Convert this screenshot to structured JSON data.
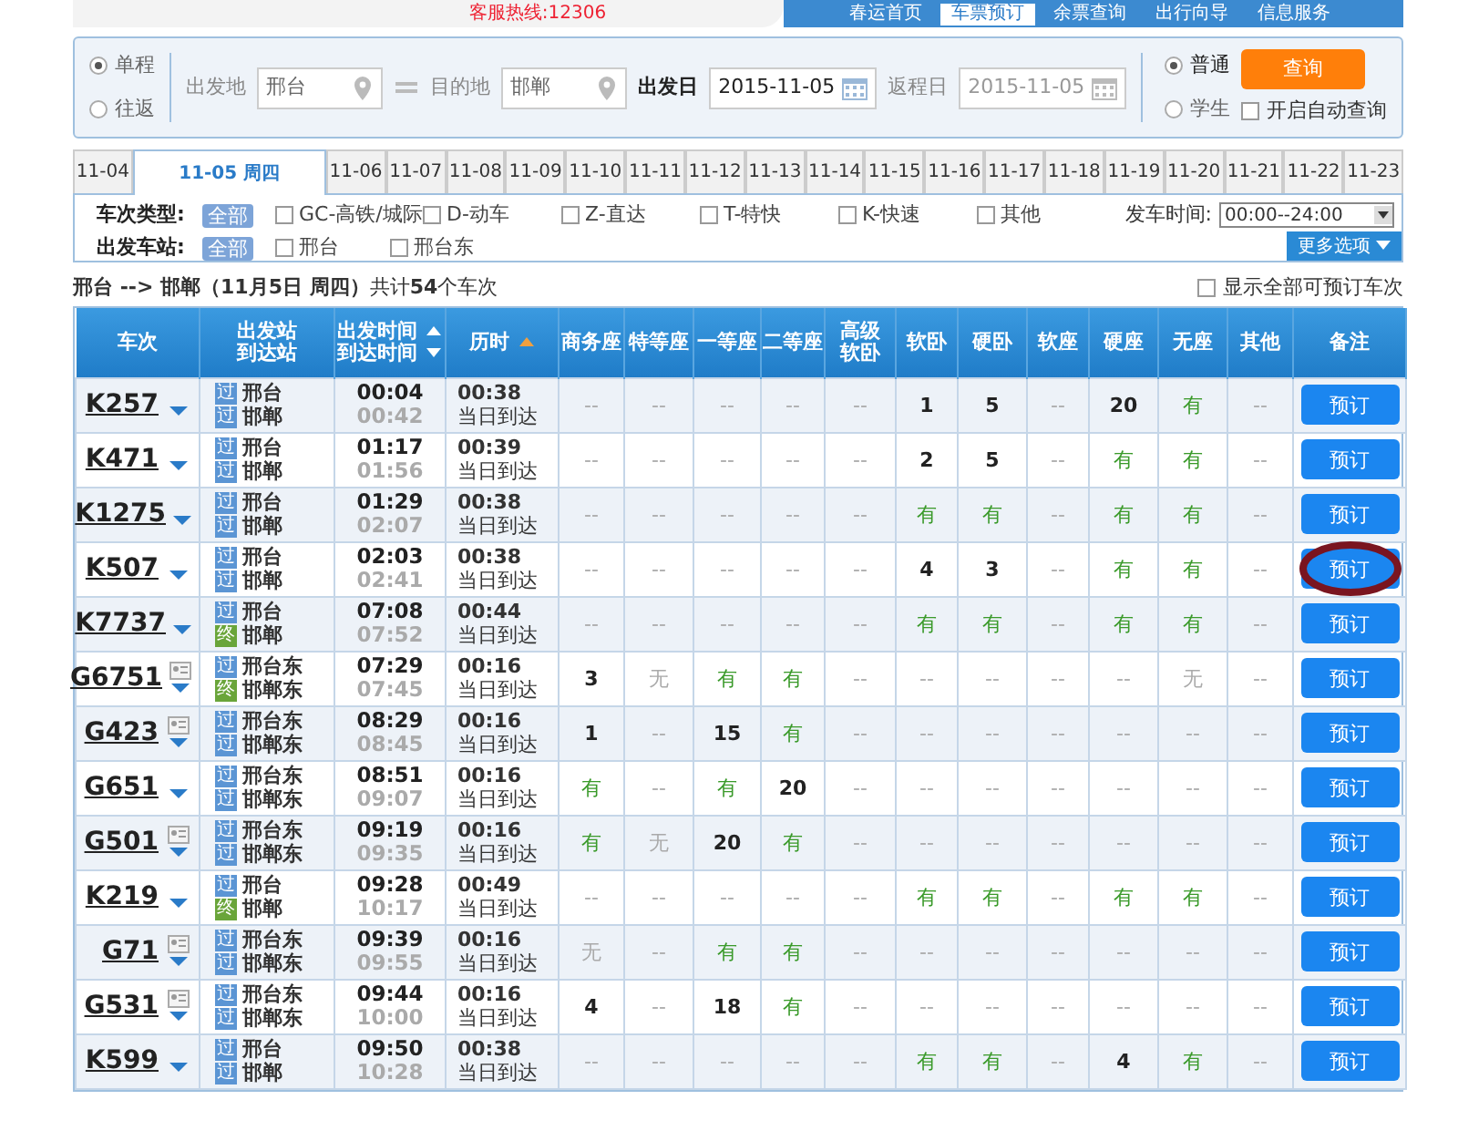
{
  "header": {
    "hotline": "客服热线:12306",
    "nav": [
      {
        "label": "春运首页",
        "selected": false
      },
      {
        "label": "车票预订",
        "selected": true
      },
      {
        "label": "余票查询",
        "selected": false
      },
      {
        "label": "出行向导",
        "selected": false
      },
      {
        "label": "信息服务",
        "selected": false
      }
    ]
  },
  "search": {
    "trip_types": [
      {
        "label": "单程",
        "selected": true
      },
      {
        "label": "往返",
        "selected": false
      }
    ],
    "from": {
      "label": "出发地",
      "value": "邢台"
    },
    "to": {
      "label": "目的地",
      "value": "邯郸"
    },
    "depart_date": {
      "label": "出发日",
      "value": "2015-11-05"
    },
    "return_date": {
      "label": "返程日",
      "value": "2015-11-05",
      "disabled": true
    },
    "passenger_types": [
      {
        "label": "普通",
        "selected": true
      },
      {
        "label": "学生",
        "selected": false
      }
    ],
    "search_button": "查询",
    "auto_query": {
      "label": "开启自动查询",
      "checked": false
    }
  },
  "date_tabs": [
    {
      "label": "11-04",
      "selected": false
    },
    {
      "label": "11-05 周四",
      "selected": true
    },
    {
      "label": "11-06",
      "selected": false
    },
    {
      "label": "11-07",
      "selected": false
    },
    {
      "label": "11-08",
      "selected": false
    },
    {
      "label": "11-09",
      "selected": false
    },
    {
      "label": "11-10",
      "selected": false
    },
    {
      "label": "11-11",
      "selected": false
    },
    {
      "label": "11-12",
      "selected": false
    },
    {
      "label": "11-13",
      "selected": false
    },
    {
      "label": "11-14",
      "selected": false
    },
    {
      "label": "11-15",
      "selected": false
    },
    {
      "label": "11-16",
      "selected": false
    },
    {
      "label": "11-17",
      "selected": false
    },
    {
      "label": "11-18",
      "selected": false
    },
    {
      "label": "11-19",
      "selected": false
    },
    {
      "label": "11-20",
      "selected": false
    },
    {
      "label": "11-21",
      "selected": false
    },
    {
      "label": "11-22",
      "selected": false
    },
    {
      "label": "11-23",
      "selected": false
    }
  ],
  "filters": {
    "train_type": {
      "label": "车次类型:",
      "all": {
        "label": "全部",
        "selected": true
      },
      "options": [
        {
          "label": "GC-高铁/城际",
          "checked": false
        },
        {
          "label": "D-动车",
          "checked": false
        },
        {
          "label": "Z-直达",
          "checked": false
        },
        {
          "label": "T-特快",
          "checked": false
        },
        {
          "label": "K-快速",
          "checked": false
        },
        {
          "label": "其他",
          "checked": false
        }
      ]
    },
    "departure_time": {
      "label": "发车时间:",
      "value": "00:00--24:00"
    },
    "station": {
      "label": "出发车站:",
      "all": {
        "label": "全部",
        "selected": true
      },
      "options": [
        {
          "label": "邢台",
          "checked": false
        },
        {
          "label": "邢台东",
          "checked": false
        }
      ]
    },
    "more_button": "更多选项"
  },
  "summary": {
    "text": "**邢台 --> 邯郸（11月5日  周四）**共计**54**个车次",
    "show_all": {
      "label": "显示全部可预订车次",
      "checked": false
    }
  },
  "table": {
    "columns": [
      {
        "lines": [
          "车次"
        ],
        "kind": "plain"
      },
      {
        "lines": [
          "出发站",
          "到达站"
        ],
        "kind": "plain"
      },
      {
        "lines": [
          "出发时间",
          "到达时间"
        ],
        "kind": "sort_pair"
      },
      {
        "lines": [
          "历时"
        ],
        "kind": "sort"
      },
      {
        "lines": [
          "商务座"
        ],
        "kind": "plain"
      },
      {
        "lines": [
          "特等座"
        ],
        "kind": "plain"
      },
      {
        "lines": [
          "一等座"
        ],
        "kind": "plain"
      },
      {
        "lines": [
          "二等座"
        ],
        "kind": "plain"
      },
      {
        "lines": [
          "高级",
          "软卧"
        ],
        "kind": "plain"
      },
      {
        "lines": [
          "软卧"
        ],
        "kind": "plain"
      },
      {
        "lines": [
          "硬卧"
        ],
        "kind": "plain"
      },
      {
        "lines": [
          "软座"
        ],
        "kind": "plain"
      },
      {
        "lines": [
          "硬座"
        ],
        "kind": "plain"
      },
      {
        "lines": [
          "无座"
        ],
        "kind": "plain"
      },
      {
        "lines": [
          "其他"
        ],
        "kind": "plain"
      },
      {
        "lines": [
          "备注"
        ],
        "kind": "plain"
      }
    ],
    "rows": [
      {
        "train": "K257",
        "id_icon": false,
        "from": {
          "tag": "过",
          "terminal": false,
          "name": "邢台"
        },
        "to": {
          "tag": "过",
          "terminal": false,
          "name": "邯郸"
        },
        "depart": "00:04",
        "arrive": "00:42",
        "duration": "00:38",
        "arrival_day": "当日到达",
        "button": "预订",
        "circled": false,
        "seats": [
          {
            "text": "--",
            "kind": "none"
          },
          {
            "text": "--",
            "kind": "none"
          },
          {
            "text": "--",
            "kind": "none"
          },
          {
            "text": "--",
            "kind": "none"
          },
          {
            "text": "--",
            "kind": "none"
          },
          {
            "text": "1",
            "kind": "count"
          },
          {
            "text": "5",
            "kind": "count"
          },
          {
            "text": "--",
            "kind": "none"
          },
          {
            "text": "20",
            "kind": "count"
          },
          {
            "text": "有",
            "kind": "available"
          },
          {
            "text": "--",
            "kind": "none"
          }
        ]
      },
      {
        "train": "K471",
        "id_icon": false,
        "from": {
          "tag": "过",
          "terminal": false,
          "name": "邢台"
        },
        "to": {
          "tag": "过",
          "terminal": false,
          "name": "邯郸"
        },
        "depart": "01:17",
        "arrive": "01:56",
        "duration": "00:39",
        "arrival_day": "当日到达",
        "button": "预订",
        "circled": false,
        "seats": [
          {
            "text": "--",
            "kind": "none"
          },
          {
            "text": "--",
            "kind": "none"
          },
          {
            "text": "--",
            "kind": "none"
          },
          {
            "text": "--",
            "kind": "none"
          },
          {
            "text": "--",
            "kind": "none"
          },
          {
            "text": "2",
            "kind": "count"
          },
          {
            "text": "5",
            "kind": "count"
          },
          {
            "text": "--",
            "kind": "none"
          },
          {
            "text": "有",
            "kind": "available"
          },
          {
            "text": "有",
            "kind": "available"
          },
          {
            "text": "--",
            "kind": "none"
          }
        ]
      },
      {
        "train": "K1275",
        "id_icon": false,
        "from": {
          "tag": "过",
          "terminal": false,
          "name": "邢台"
        },
        "to": {
          "tag": "过",
          "terminal": false,
          "name": "邯郸"
        },
        "depart": "01:29",
        "arrive": "02:07",
        "duration": "00:38",
        "arrival_day": "当日到达",
        "button": "预订",
        "circled": false,
        "seats": [
          {
            "text": "--",
            "kind": "none"
          },
          {
            "text": "--",
            "kind": "none"
          },
          {
            "text": "--",
            "kind": "none"
          },
          {
            "text": "--",
            "kind": "none"
          },
          {
            "text": "--",
            "kind": "none"
          },
          {
            "text": "有",
            "kind": "available"
          },
          {
            "text": "有",
            "kind": "available"
          },
          {
            "text": "--",
            "kind": "none"
          },
          {
            "text": "有",
            "kind": "available"
          },
          {
            "text": "有",
            "kind": "available"
          },
          {
            "text": "--",
            "kind": "none"
          }
        ]
      },
      {
        "train": "K507",
        "id_icon": false,
        "from": {
          "tag": "过",
          "terminal": false,
          "name": "邢台"
        },
        "to": {
          "tag": "过",
          "terminal": false,
          "name": "邯郸"
        },
        "depart": "02:03",
        "arrive": "02:41",
        "duration": "00:38",
        "arrival_day": "当日到达",
        "button": "预订",
        "circled": true,
        "seats": [
          {
            "text": "--",
            "kind": "none"
          },
          {
            "text": "--",
            "kind": "none"
          },
          {
            "text": "--",
            "kind": "none"
          },
          {
            "text": "--",
            "kind": "none"
          },
          {
            "text": "--",
            "kind": "none"
          },
          {
            "text": "4",
            "kind": "count"
          },
          {
            "text": "3",
            "kind": "count"
          },
          {
            "text": "--",
            "kind": "none"
          },
          {
            "text": "有",
            "kind": "available"
          },
          {
            "text": "有",
            "kind": "available"
          },
          {
            "text": "--",
            "kind": "none"
          }
        ]
      },
      {
        "train": "K7737",
        "id_icon": false,
        "from": {
          "tag": "过",
          "terminal": false,
          "name": "邢台"
        },
        "to": {
          "tag": "终",
          "terminal": true,
          "name": "邯郸"
        },
        "depart": "07:08",
        "arrive": "07:52",
        "duration": "00:44",
        "arrival_day": "当日到达",
        "button": "预订",
        "circled": false,
        "seats": [
          {
            "text": "--",
            "kind": "none"
          },
          {
            "text": "--",
            "kind": "none"
          },
          {
            "text": "--",
            "kind": "none"
          },
          {
            "text": "--",
            "kind": "none"
          },
          {
            "text": "--",
            "kind": "none"
          },
          {
            "text": "有",
            "kind": "available"
          },
          {
            "text": "有",
            "kind": "available"
          },
          {
            "text": "--",
            "kind": "none"
          },
          {
            "text": "有",
            "kind": "available"
          },
          {
            "text": "有",
            "kind": "available"
          },
          {
            "text": "--",
            "kind": "none"
          }
        ]
      },
      {
        "train": "G6751",
        "id_icon": true,
        "from": {
          "tag": "过",
          "terminal": false,
          "name": "邢台东"
        },
        "to": {
          "tag": "终",
          "terminal": true,
          "name": "邯郸东"
        },
        "depart": "07:29",
        "arrive": "07:45",
        "duration": "00:16",
        "arrival_day": "当日到达",
        "button": "预订",
        "circled": false,
        "seats": [
          {
            "text": "3",
            "kind": "count"
          },
          {
            "text": "无",
            "kind": "soldout"
          },
          {
            "text": "有",
            "kind": "available"
          },
          {
            "text": "有",
            "kind": "available"
          },
          {
            "text": "--",
            "kind": "none"
          },
          {
            "text": "--",
            "kind": "none"
          },
          {
            "text": "--",
            "kind": "none"
          },
          {
            "text": "--",
            "kind": "none"
          },
          {
            "text": "--",
            "kind": "none"
          },
          {
            "text": "无",
            "kind": "soldout"
          },
          {
            "text": "--",
            "kind": "none"
          }
        ]
      },
      {
        "train": "G423",
        "id_icon": true,
        "from": {
          "tag": "过",
          "terminal": false,
          "name": "邢台东"
        },
        "to": {
          "tag": "过",
          "terminal": false,
          "name": "邯郸东"
        },
        "depart": "08:29",
        "arrive": "08:45",
        "duration": "00:16",
        "arrival_day": "当日到达",
        "button": "预订",
        "circled": false,
        "seats": [
          {
            "text": "1",
            "kind": "count"
          },
          {
            "text": "--",
            "kind": "none"
          },
          {
            "text": "15",
            "kind": "count"
          },
          {
            "text": "有",
            "kind": "available"
          },
          {
            "text": "--",
            "kind": "none"
          },
          {
            "text": "--",
            "kind": "none"
          },
          {
            "text": "--",
            "kind": "none"
          },
          {
            "text": "--",
            "kind": "none"
          },
          {
            "text": "--",
            "kind": "none"
          },
          {
            "text": "--",
            "kind": "none"
          },
          {
            "text": "--",
            "kind": "none"
          }
        ]
      },
      {
        "train": "G651",
        "id_icon": false,
        "from": {
          "tag": "过",
          "terminal": false,
          "name": "邢台东"
        },
        "to": {
          "tag": "过",
          "terminal": false,
          "name": "邯郸东"
        },
        "depart": "08:51",
        "arrive": "09:07",
        "duration": "00:16",
        "arrival_day": "当日到达",
        "button": "预订",
        "circled": false,
        "seats": [
          {
            "text": "有",
            "kind": "available"
          },
          {
            "text": "--",
            "kind": "none"
          },
          {
            "text": "有",
            "kind": "available"
          },
          {
            "text": "20",
            "kind": "count"
          },
          {
            "text": "--",
            "kind": "none"
          },
          {
            "text": "--",
            "kind": "none"
          },
          {
            "text": "--",
            "kind": "none"
          },
          {
            "text": "--",
            "kind": "none"
          },
          {
            "text": "--",
            "kind": "none"
          },
          {
            "text": "--",
            "kind": "none"
          },
          {
            "text": "--",
            "kind": "none"
          }
        ]
      },
      {
        "train": "G501",
        "id_icon": true,
        "from": {
          "tag": "过",
          "terminal": false,
          "name": "邢台东"
        },
        "to": {
          "tag": "过",
          "terminal": false,
          "name": "邯郸东"
        },
        "depart": "09:19",
        "arrive": "09:35",
        "duration": "00:16",
        "arrival_day": "当日到达",
        "button": "预订",
        "circled": false,
        "seats": [
          {
            "text": "有",
            "kind": "available"
          },
          {
            "text": "无",
            "kind": "soldout"
          },
          {
            "text": "20",
            "kind": "count"
          },
          {
            "text": "有",
            "kind": "available"
          },
          {
            "text": "--",
            "kind": "none"
          },
          {
            "text": "--",
            "kind": "none"
          },
          {
            "text": "--",
            "kind": "none"
          },
          {
            "text": "--",
            "kind": "none"
          },
          {
            "text": "--",
            "kind": "none"
          },
          {
            "text": "--",
            "kind": "none"
          },
          {
            "text": "--",
            "kind": "none"
          }
        ]
      },
      {
        "train": "K219",
        "id_icon": false,
        "from": {
          "tag": "过",
          "terminal": false,
          "name": "邢台"
        },
        "to": {
          "tag": "终",
          "terminal": true,
          "name": "邯郸"
        },
        "depart": "09:28",
        "arrive": "10:17",
        "duration": "00:49",
        "arrival_day": "当日到达",
        "button": "预订",
        "circled": false,
        "seats": [
          {
            "text": "--",
            "kind": "none"
          },
          {
            "text": "--",
            "kind": "none"
          },
          {
            "text": "--",
            "kind": "none"
          },
          {
            "text": "--",
            "kind": "none"
          },
          {
            "text": "--",
            "kind": "none"
          },
          {
            "text": "有",
            "kind": "available"
          },
          {
            "text": "有",
            "kind": "available"
          },
          {
            "text": "--",
            "kind": "none"
          },
          {
            "text": "有",
            "kind": "available"
          },
          {
            "text": "有",
            "kind": "available"
          },
          {
            "text": "--",
            "kind": "none"
          }
        ]
      },
      {
        "train": "G71",
        "id_icon": true,
        "from": {
          "tag": "过",
          "terminal": false,
          "name": "邢台东"
        },
        "to": {
          "tag": "过",
          "terminal": false,
          "name": "邯郸东"
        },
        "depart": "09:39",
        "arrive": "09:55",
        "duration": "00:16",
        "arrival_day": "当日到达",
        "button": "预订",
        "circled": false,
        "seats": [
          {
            "text": "无",
            "kind": "soldout"
          },
          {
            "text": "--",
            "kind": "none"
          },
          {
            "text": "有",
            "kind": "available"
          },
          {
            "text": "有",
            "kind": "available"
          },
          {
            "text": "--",
            "kind": "none"
          },
          {
            "text": "--",
            "kind": "none"
          },
          {
            "text": "--",
            "kind": "none"
          },
          {
            "text": "--",
            "kind": "none"
          },
          {
            "text": "--",
            "kind": "none"
          },
          {
            "text": "--",
            "kind": "none"
          },
          {
            "text": "--",
            "kind": "none"
          }
        ]
      },
      {
        "train": "G531",
        "id_icon": true,
        "from": {
          "tag": "过",
          "terminal": false,
          "name": "邢台东"
        },
        "to": {
          "tag": "过",
          "terminal": false,
          "name": "邯郸东"
        },
        "depart": "09:44",
        "arrive": "10:00",
        "duration": "00:16",
        "arrival_day": "当日到达",
        "button": "预订",
        "circled": false,
        "seats": [
          {
            "text": "4",
            "kind": "count"
          },
          {
            "text": "--",
            "kind": "none"
          },
          {
            "text": "18",
            "kind": "count"
          },
          {
            "text": "有",
            "kind": "available"
          },
          {
            "text": "--",
            "kind": "none"
          },
          {
            "text": "--",
            "kind": "none"
          },
          {
            "text": "--",
            "kind": "none"
          },
          {
            "text": "--",
            "kind": "none"
          },
          {
            "text": "--",
            "kind": "none"
          },
          {
            "text": "--",
            "kind": "none"
          },
          {
            "text": "--",
            "kind": "none"
          }
        ]
      },
      {
        "train": "K599",
        "id_icon": false,
        "from": {
          "tag": "过",
          "terminal": false,
          "name": "邢台"
        },
        "to": {
          "tag": "过",
          "terminal": false,
          "name": "邯郸"
        },
        "depart": "09:50",
        "arrive": "10:28",
        "duration": "00:38",
        "arrival_day": "当日到达",
        "button": "预订",
        "circled": false,
        "seats": [
          {
            "text": "--",
            "kind": "none"
          },
          {
            "text": "--",
            "kind": "none"
          },
          {
            "text": "--",
            "kind": "none"
          },
          {
            "text": "--",
            "kind": "none"
          },
          {
            "text": "--",
            "kind": "none"
          },
          {
            "text": "有",
            "kind": "available"
          },
          {
            "text": "有",
            "kind": "available"
          },
          {
            "text": "--",
            "kind": "none"
          },
          {
            "text": "4",
            "kind": "count"
          },
          {
            "text": "有",
            "kind": "available"
          },
          {
            "text": "--",
            "kind": "none"
          }
        ]
      }
    ]
  }
}
